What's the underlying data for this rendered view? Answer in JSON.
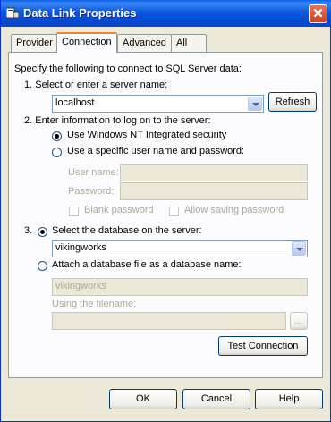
{
  "window": {
    "title": "Data Link Properties"
  },
  "tabs": [
    "Provider",
    "Connection",
    "Advanced",
    "All"
  ],
  "content": {
    "intro": "Specify the following to connect to SQL Server data:",
    "step1": "1. Select or enter a server name:",
    "server_value": "localhost",
    "refresh": "Refresh",
    "step2": "2. Enter information to log on to the server:",
    "opt_nt": "Use Windows NT Integrated security",
    "opt_specific": "Use a specific user name and password:",
    "user_label": "User name:",
    "pass_label": "Password:",
    "blank_pw": "Blank password",
    "allow_save": "Allow saving password",
    "step3_num": "3.",
    "opt_select_db": "Select the database on the server:",
    "db_value": "vikingworks",
    "opt_attach": "Attach a database file as a database name:",
    "attach_value": "vikingworks",
    "using_filename": "Using the filename:",
    "browse": "...",
    "test": "Test Connection"
  },
  "footer": {
    "ok": "OK",
    "cancel": "Cancel",
    "help": "Help"
  }
}
